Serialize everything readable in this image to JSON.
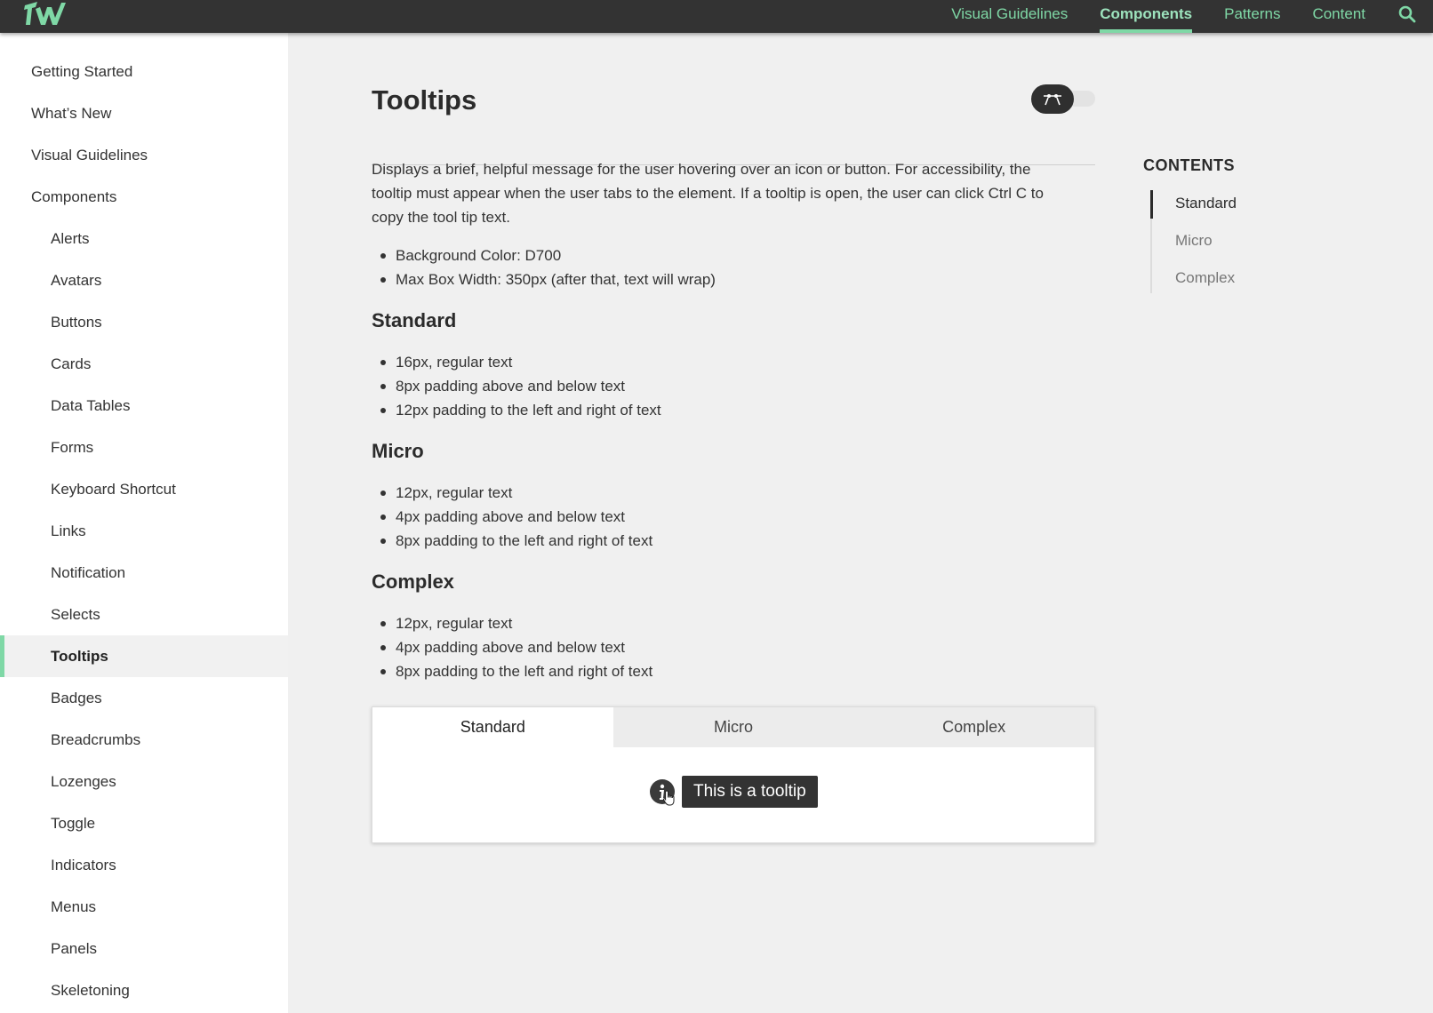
{
  "brand": {
    "logo_text": "TW",
    "accent_color": "#7fd8a6"
  },
  "topnav": {
    "items": [
      {
        "label": "Visual Guidelines",
        "active": false
      },
      {
        "label": "Components",
        "active": true
      },
      {
        "label": "Patterns",
        "active": false
      },
      {
        "label": "Content",
        "active": false
      }
    ],
    "search_icon": "search-icon"
  },
  "sidebar": {
    "items": [
      {
        "label": "Getting Started",
        "level": 0
      },
      {
        "label": "What’s New",
        "level": 0
      },
      {
        "label": "Visual Guidelines",
        "level": 0
      },
      {
        "label": "Components",
        "level": 0
      },
      {
        "label": "Alerts",
        "level": 1
      },
      {
        "label": "Avatars",
        "level": 1
      },
      {
        "label": "Buttons",
        "level": 1
      },
      {
        "label": "Cards",
        "level": 1
      },
      {
        "label": "Data Tables",
        "level": 1
      },
      {
        "label": "Forms",
        "level": 1
      },
      {
        "label": "Keyboard Shortcut",
        "level": 1
      },
      {
        "label": "Links",
        "level": 1
      },
      {
        "label": "Notification",
        "level": 1
      },
      {
        "label": "Selects",
        "level": 1
      },
      {
        "label": "Tooltips",
        "level": 1,
        "active": true
      },
      {
        "label": "Badges",
        "level": 1
      },
      {
        "label": "Breadcrumbs",
        "level": 1
      },
      {
        "label": "Lozenges",
        "level": 1
      },
      {
        "label": "Toggle",
        "level": 1
      },
      {
        "label": "Indicators",
        "level": 1
      },
      {
        "label": "Menus",
        "level": 1
      },
      {
        "label": "Panels",
        "level": 1
      },
      {
        "label": "Skeletoning",
        "level": 1
      }
    ]
  },
  "main": {
    "title": "Tooltips",
    "mode_toggle_icon": "developer-mode-icon",
    "description": "Displays a brief, helpful message for the user hovering over an icon or button. For accessibility, the tooltip must appear when the user tabs to the element. If a tooltip is open, the user can click Ctrl C to copy the tool tip text.",
    "general_bullets": [
      "Background Color: D700",
      "Max Box Width: 350px (after that, text will wrap)"
    ],
    "sections": {
      "standard": {
        "heading": "Standard",
        "bullets": [
          "16px, regular text",
          "8px padding above and below text",
          "12px padding to the left and right of text"
        ]
      },
      "micro": {
        "heading": "Micro",
        "bullets": [
          "12px, regular text",
          "4px padding above and below text",
          "8px padding to the left and right of text"
        ]
      },
      "complex": {
        "heading": "Complex",
        "bullets": [
          "12px, regular text",
          "4px padding above and below text",
          "8px padding to the left and right of text"
        ]
      }
    },
    "demo": {
      "tabs": [
        {
          "label": "Standard",
          "active": true
        },
        {
          "label": "Micro",
          "active": false
        },
        {
          "label": "Complex",
          "active": false
        }
      ],
      "tooltip_text": "This is a tooltip",
      "trigger_icon": "info-icon"
    }
  },
  "toc": {
    "title": "CONTENTS",
    "items": [
      {
        "label": "Standard",
        "active": true
      },
      {
        "label": "Micro",
        "active": false
      },
      {
        "label": "Complex",
        "active": false
      }
    ]
  }
}
